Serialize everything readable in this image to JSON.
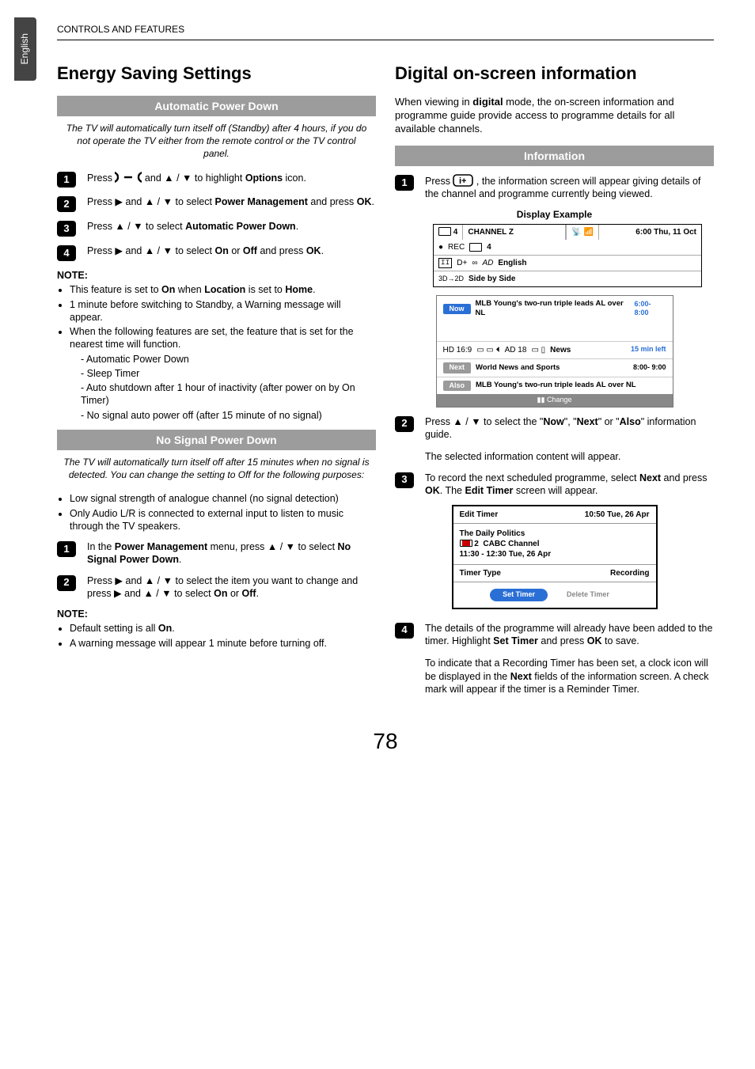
{
  "header": "CONTROLS AND FEATURES",
  "langTab": "English",
  "pageNumber": "78",
  "left": {
    "title": "Energy Saving Settings",
    "sec1": {
      "bar": "Automatic Power Down",
      "intro": "The TV will automatically turn itself off (Standby) after 4 hours, if you do not operate the TV either from the remote control or the TV control panel.",
      "step1_a": "Press ",
      "step1_b": " and ▲ / ▼ to highlight ",
      "step1_c": "Options",
      "step1_d": " icon.",
      "step2_a": "Press ▶ and ▲ / ▼ to select ",
      "step2_b": "Power Management",
      "step2_c": " and press ",
      "step2_d": "OK",
      "step2_e": ".",
      "step3_a": "Press ▲ / ▼ to select ",
      "step3_b": "Automatic Power Down",
      "step3_c": ".",
      "step4_a": "Press ▶ and ▲ / ▼ to select ",
      "step4_b": "On",
      "step4_c": " or ",
      "step4_d": "Off",
      "step4_e": " and press ",
      "step4_f": "OK",
      "step4_g": ".",
      "noteHead": "NOTE:",
      "n1_a": "This feature is set to ",
      "n1_b": "On",
      "n1_c": " when ",
      "n1_d": "Location",
      "n1_e": " is set to ",
      "n1_f": "Home",
      "n1_g": ".",
      "n2": "1 minute before switching to Standby, a Warning message will appear.",
      "n3": "When the following features are set, the feature that is set for the nearest time will function.",
      "s1": "Automatic Power Down",
      "s2": "Sleep Timer",
      "s3": "Auto shutdown after 1 hour of inactivity (after power on by On Timer)",
      "s4": "No signal auto power off (after 15 minute of no signal)"
    },
    "sec2": {
      "bar": "No Signal Power Down",
      "intro": "The TV will automatically turn itself off after 15 minutes when no signal is detected. You can change the setting to Off for the following purposes:",
      "b1": "Low signal strength of analogue channel (no signal detection)",
      "b2": "Only Audio L/R is connected to external input to listen to music through the TV speakers.",
      "step1_a": "In the ",
      "step1_b": "Power Management",
      "step1_c": " menu, press ▲ / ▼ to select ",
      "step1_d": "No Signal Power Down",
      "step1_e": ".",
      "step2_a": "Press ▶ and ▲ / ▼ to select the item you want to change and press ▶ and ▲ / ▼ to select ",
      "step2_b": "On",
      "step2_c": " or ",
      "step2_d": "Off",
      "step2_e": ".",
      "noteHead": "NOTE:",
      "nn1_a": "Default setting is all ",
      "nn1_b": "On",
      "nn1_c": ".",
      "nn2": "A warning message will appear 1 minute before turning off."
    }
  },
  "right": {
    "title": "Digital on-screen information",
    "intro_a": "When viewing in ",
    "intro_b": "digital",
    "intro_c": " mode, the on-screen information and programme guide provide access to programme details for all available channels.",
    "bar": "Information",
    "step1_a": "Press ",
    "step1_b": ", the information screen will appear giving details of the channel and programme currently being viewed.",
    "dispExTitle": "Display Example",
    "ib1": {
      "chNum": "4",
      "chName": "CHANNEL Z",
      "clock": "6:00 Thu, 11 Oct",
      "rec": "REC",
      "recNum": "4",
      "lang": "English",
      "sbs": "Side by Side",
      "d3d": "3D→2D",
      "dplus": "D+",
      "ad": "AD"
    },
    "ib2": {
      "nowLabel": "Now",
      "nowText": "MLB Young's two-run triple leads AL over NL",
      "nowTime": "6:00- 8:00",
      "meta_a": "HD  16:9",
      "meta_b": "AD  18",
      "meta_c": "News",
      "left15": "15 min left",
      "nextLabel": "Next",
      "nextText": "World News and Sports",
      "nextTime": "8:00- 9:00",
      "alsoLabel": "Also",
      "alsoText": "MLB Young's two-run triple leads AL over NL",
      "change": "Change"
    },
    "step2_a": "Press ▲ / ▼ to select the \"",
    "step2_b": "Now",
    "step2_c": "\", \"",
    "step2_d": "Next",
    "step2_e": "\" or \"",
    "step2_f": "Also",
    "step2_g": "\" information guide.",
    "step2_h": "The selected information content will appear.",
    "step3_a": "To record the next scheduled programme, select ",
    "step3_b": "Next",
    "step3_c": " and press ",
    "step3_d": "OK",
    "step3_e": ". The ",
    "step3_f": "Edit Timer",
    "step3_g": " screen will appear.",
    "et": {
      "title": "Edit Timer",
      "dt": "10:50 Tue, 26 Apr",
      "prog": "The Daily Politics",
      "chNum": "2",
      "ch": "CABC  Channel",
      "when": "11:30 - 12:30 Tue, 26 Apr",
      "tt": "Timer Type",
      "rec": "Recording",
      "set": "Set Timer",
      "del": "Delete Timer"
    },
    "step4_a": "The details of the programme will already have been added to the timer. Highlight ",
    "step4_b": "Set Timer",
    "step4_c": " and press ",
    "step4_d": "OK",
    "step4_e": " to save.",
    "step4_f_a": "To indicate that a Recording Timer has been set, a clock icon will be displayed in the ",
    "step4_f_b": "Next",
    "step4_f_c": " fields of the information screen. A check mark will appear if the timer is a Reminder Timer."
  }
}
